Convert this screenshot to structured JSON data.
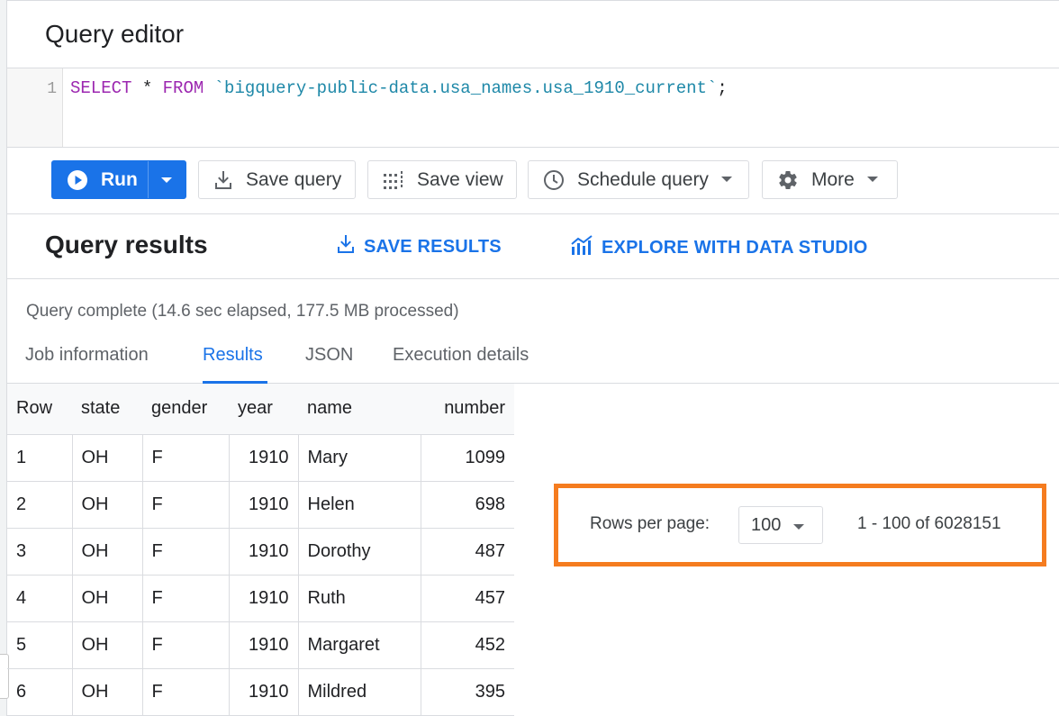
{
  "editor": {
    "title": "Query editor",
    "line_number": "1",
    "code": {
      "keyword_select": "SELECT",
      "star": " * ",
      "keyword_from": "FROM",
      "space": " ",
      "table_ref": "`bigquery-public-data.usa_names.usa_1910_current`",
      "terminator": ";"
    }
  },
  "toolbar": {
    "run_label": "Run",
    "save_query_label": "Save query",
    "save_view_label": "Save view",
    "schedule_query_label": "Schedule query",
    "more_label": "More"
  },
  "results": {
    "title": "Query results",
    "save_results_label": "SAVE RESULTS",
    "explore_label": "EXPLORE WITH DATA STUDIO",
    "status": "Query complete (14.6 sec elapsed, 177.5 MB processed)",
    "tabs": [
      {
        "label": "Job information",
        "active": false
      },
      {
        "label": "Results",
        "active": true
      },
      {
        "label": "JSON",
        "active": false
      },
      {
        "label": "Execution details",
        "active": false
      }
    ],
    "columns": [
      "Row",
      "state",
      "gender",
      "year",
      "name",
      "number"
    ],
    "rows": [
      [
        "1",
        "OH",
        "F",
        "1910",
        "Mary",
        "1099"
      ],
      [
        "2",
        "OH",
        "F",
        "1910",
        "Helen",
        "698"
      ],
      [
        "3",
        "OH",
        "F",
        "1910",
        "Dorothy",
        "487"
      ],
      [
        "4",
        "OH",
        "F",
        "1910",
        "Ruth",
        "457"
      ],
      [
        "5",
        "OH",
        "F",
        "1910",
        "Margaret",
        "452"
      ],
      [
        "6",
        "OH",
        "F",
        "1910",
        "Mildred",
        "395"
      ]
    ]
  },
  "pagination": {
    "rows_per_page_label": "Rows per page:",
    "rows_per_page_value": "100",
    "range_text": "1 - 100 of 6028151"
  },
  "colors": {
    "accent": "#1a73e8",
    "highlight": "#f57c1f",
    "sql_keyword": "#9c27b0",
    "sql_string": "#1e88a8"
  },
  "icons": [
    "play-icon",
    "chevron-down-icon",
    "download-icon",
    "grid-dots-icon",
    "clock-icon",
    "gear-icon",
    "chart-icon"
  ]
}
